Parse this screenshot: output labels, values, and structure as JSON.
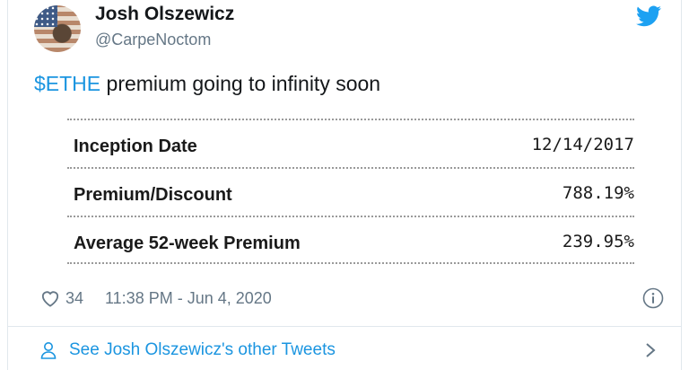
{
  "tweet": {
    "author_name": "Josh Olszewicz",
    "author_handle": "@CarpeNoctom",
    "text_cashtag": "$ETHE",
    "text_rest": " premium going to infinity soon",
    "table": [
      {
        "label": "Inception Date",
        "value": "12/14/2017"
      },
      {
        "label": "Premium/Discount",
        "value": "788.19%"
      },
      {
        "label": "Average 52-week Premium",
        "value": "239.95%"
      }
    ],
    "likes": "34",
    "timestamp": "11:38 PM - Jun 4, 2020",
    "see_more": "See Josh Olszewicz's other Tweets"
  },
  "colors": {
    "link": "#1b95e0",
    "muted": "#657786",
    "twitter_blue": "#1da1f2"
  },
  "icons": [
    "twitter-bird-icon",
    "heart-icon",
    "info-icon",
    "person-icon",
    "chevron-right-icon"
  ]
}
